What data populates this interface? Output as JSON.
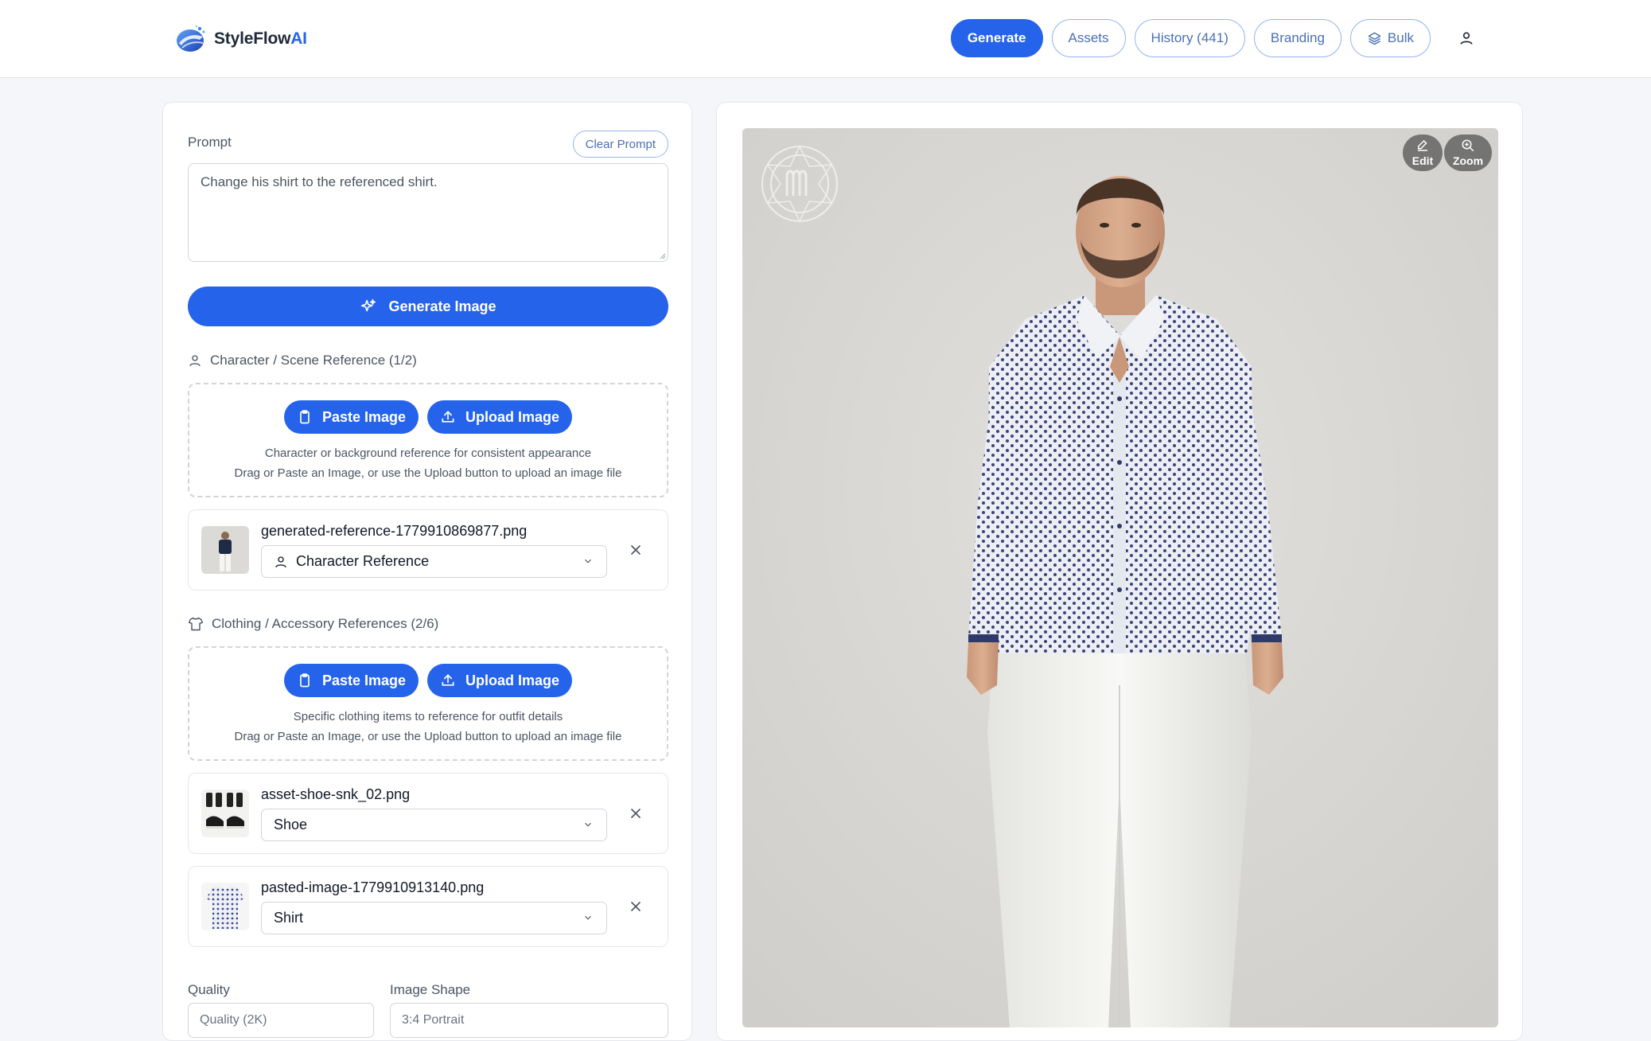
{
  "app": {
    "brand_name": "StyleFlow",
    "brand_suffix": "AI"
  },
  "nav": {
    "items": [
      {
        "label": "Generate",
        "active": true
      },
      {
        "label": "Assets"
      },
      {
        "label": "History (441)"
      },
      {
        "label": "Branding"
      },
      {
        "label": "Bulk",
        "icon": "layers-icon"
      }
    ],
    "user_icon": "user-icon"
  },
  "prompt": {
    "label": "Prompt",
    "clear_label": "Clear Prompt",
    "value": "Change his shirt to the referenced shirt."
  },
  "generate_button": {
    "label": "Generate Image",
    "icon": "sparkles-icon"
  },
  "character_section": {
    "title": "Character / Scene Reference (1/2)",
    "paste_label": "Paste Image",
    "upload_label": "Upload Image",
    "hint_line1": "Character or background reference for consistent appearance",
    "hint_line2": "Drag or Paste an Image, or use the Upload button to upload an image file",
    "items": [
      {
        "filename": "generated-reference-1779910869877.png",
        "type": "Character Reference"
      }
    ]
  },
  "clothing_section": {
    "title": "Clothing / Accessory References (2/6)",
    "paste_label": "Paste Image",
    "upload_label": "Upload Image",
    "hint_line1": "Specific clothing items to reference for outfit details",
    "hint_line2": "Drag or Paste an Image, or use the Upload button to upload an image file",
    "items": [
      {
        "filename": "asset-shoe-snk_02.png",
        "type": "Shoe"
      },
      {
        "filename": "pasted-image-1779910913140.png",
        "type": "Shirt"
      }
    ]
  },
  "options": {
    "quality_label": "Quality",
    "quality_value": "Quality (2K)",
    "shape_label": "Image Shape",
    "shape_value": "3:4 Portrait"
  },
  "preview": {
    "edit_label": "Edit",
    "zoom_label": "Zoom"
  },
  "colors": {
    "accent": "#2563eb",
    "accent_border": "#93b4f0",
    "background": "#f4f6f9"
  }
}
